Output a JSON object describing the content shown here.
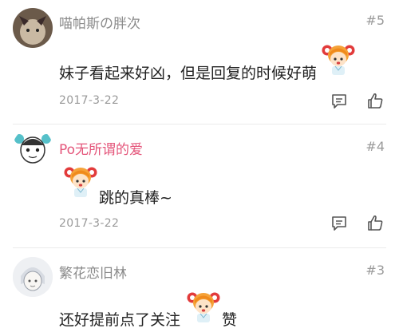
{
  "comments": [
    {
      "username": "喵帕斯の胖次",
      "floor": "#5",
      "text": "妹子看起来好凶，但是回复的时候好萌",
      "date": "2017-3-22",
      "avatar_icon": "devil-horns-avatar-icon",
      "sticker_icon": "orange-haired-girl-sticker-icon"
    },
    {
      "username": "Po无所谓的爱",
      "floor": "#4",
      "text": "跳的真棒~",
      "date": "2017-3-22",
      "avatar_icon": "cartoon-face-avatar-icon",
      "sticker_icon": "orange-haired-girl-sticker-icon"
    },
    {
      "username": "繁花恋旧林",
      "floor": "#3",
      "text_before": "还好提前点了关注",
      "text_after": "赞",
      "avatar_icon": "anime-boy-avatar-icon",
      "sticker_icon": "orange-haired-girl-sticker-icon"
    }
  ],
  "colors": {
    "username_gray": "#8a8a8a",
    "username_pink": "#e4557a",
    "text": "#222222",
    "meta": "#9a9a9a"
  }
}
